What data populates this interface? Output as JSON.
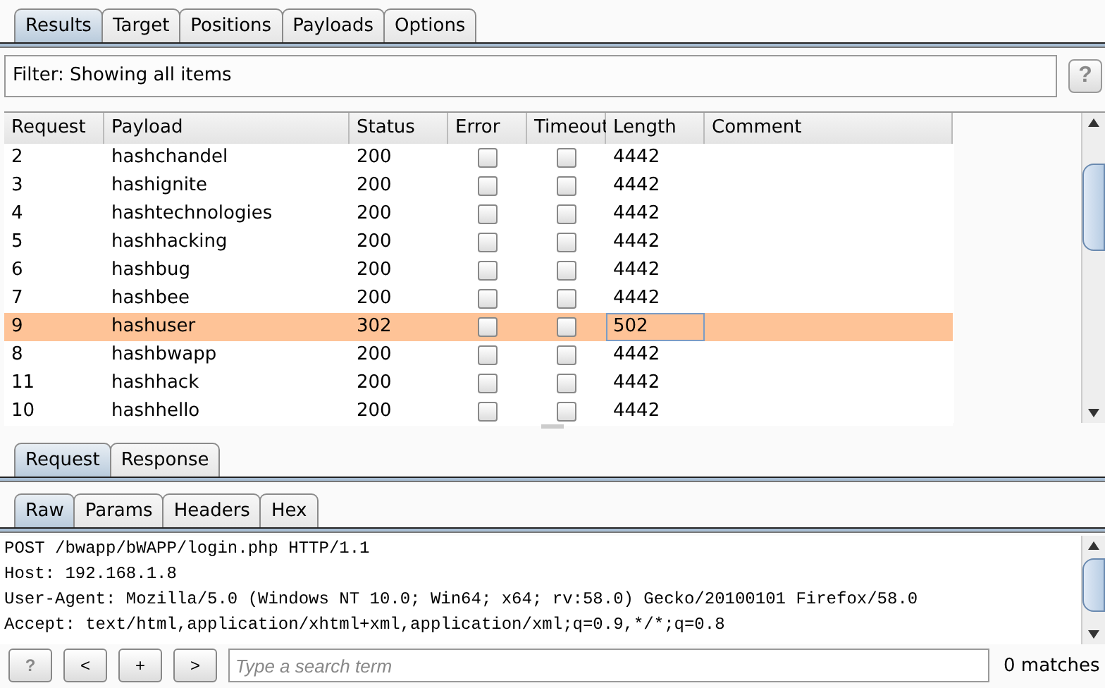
{
  "tabs": [
    {
      "label": "Results",
      "selected": true
    },
    {
      "label": "Target",
      "selected": false
    },
    {
      "label": "Positions",
      "selected": false
    },
    {
      "label": "Payloads",
      "selected": false
    },
    {
      "label": "Options",
      "selected": false
    }
  ],
  "filter": {
    "text": "Filter: Showing all items",
    "help": "?"
  },
  "table": {
    "columns": [
      "Request",
      "Payload",
      "Status",
      "Error",
      "Timeout",
      "Length",
      "Comment"
    ],
    "rows": [
      {
        "request": "2",
        "payload": "hashchandel",
        "status": "200",
        "error": false,
        "timeout": false,
        "length": "4442",
        "selected": false,
        "length_focused": false
      },
      {
        "request": "3",
        "payload": "hashignite",
        "status": "200",
        "error": false,
        "timeout": false,
        "length": "4442",
        "selected": false,
        "length_focused": false
      },
      {
        "request": "4",
        "payload": "hashtechnologies",
        "status": "200",
        "error": false,
        "timeout": false,
        "length": "4442",
        "selected": false,
        "length_focused": false
      },
      {
        "request": "5",
        "payload": "hashhacking",
        "status": "200",
        "error": false,
        "timeout": false,
        "length": "4442",
        "selected": false,
        "length_focused": false
      },
      {
        "request": "6",
        "payload": "hashbug",
        "status": "200",
        "error": false,
        "timeout": false,
        "length": "4442",
        "selected": false,
        "length_focused": false
      },
      {
        "request": "7",
        "payload": "hashbee",
        "status": "200",
        "error": false,
        "timeout": false,
        "length": "4442",
        "selected": false,
        "length_focused": false
      },
      {
        "request": "9",
        "payload": "hashuser",
        "status": "302",
        "error": false,
        "timeout": false,
        "length": "502",
        "selected": true,
        "length_focused": true
      },
      {
        "request": "8",
        "payload": "hashbwapp",
        "status": "200",
        "error": false,
        "timeout": false,
        "length": "4442",
        "selected": false,
        "length_focused": false
      },
      {
        "request": "11",
        "payload": "hashhack",
        "status": "200",
        "error": false,
        "timeout": false,
        "length": "4442",
        "selected": false,
        "length_focused": false
      },
      {
        "request": "10",
        "payload": "hashhello",
        "status": "200",
        "error": false,
        "timeout": false,
        "length": "4442",
        "selected": false,
        "length_focused": false
      }
    ]
  },
  "message_tabs": [
    {
      "label": "Request",
      "selected": true
    },
    {
      "label": "Response",
      "selected": false
    }
  ],
  "view_tabs": [
    {
      "label": "Raw",
      "selected": true
    },
    {
      "label": "Params",
      "selected": false
    },
    {
      "label": "Headers",
      "selected": false
    },
    {
      "label": "Hex",
      "selected": false
    }
  ],
  "raw_lines": [
    "POST /bwapp/bWAPP/login.php HTTP/1.1",
    "Host: 192.168.1.8",
    "User-Agent: Mozilla/5.0 (Windows NT 10.0; Win64; x64; rv:58.0) Gecko/20100101 Firefox/58.0",
    "Accept: text/html,application/xhtml+xml,application/xml;q=0.9,*/*;q=0.8"
  ],
  "search_bar": {
    "buttons": [
      "?",
      "<",
      "+",
      ">"
    ],
    "placeholder": "Type a search term",
    "matches": "0 matches"
  }
}
